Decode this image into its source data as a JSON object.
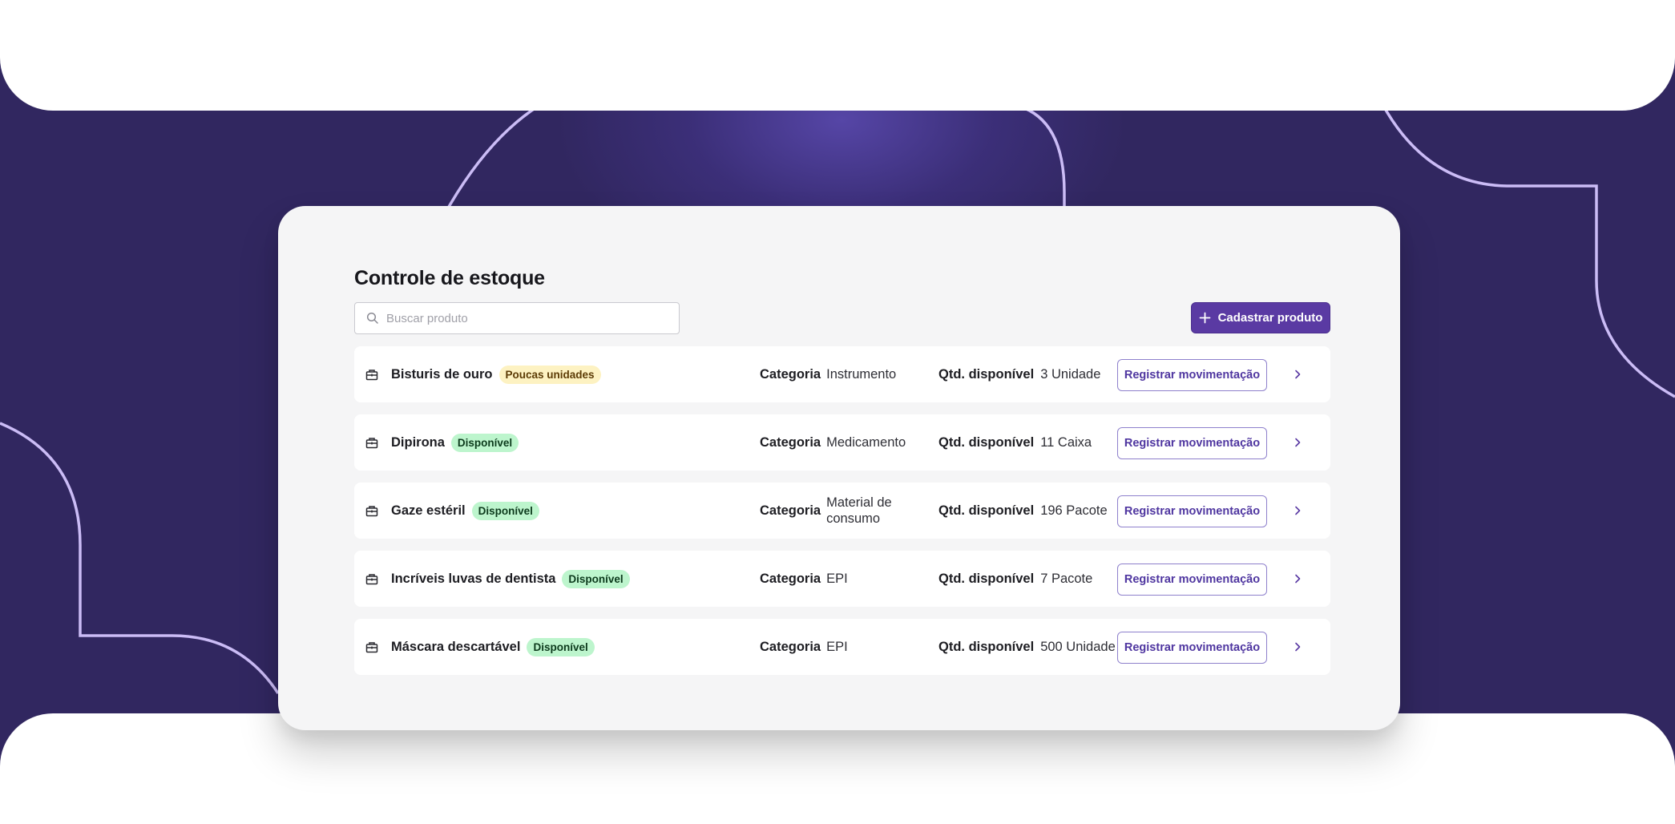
{
  "colors": {
    "background": "#312760",
    "accent": "#5a3aa3",
    "decoration_line": "#cbbcf6",
    "badge_low_bg": "#fdf2c2",
    "badge_ok_bg": "#bdf5cd"
  },
  "page": {
    "title": "Controle de estoque",
    "search_placeholder": "Buscar produto",
    "search_icon": "search-icon",
    "add_button_label": "Cadastrar produto",
    "add_button_icon": "plus-icon"
  },
  "rows": [
    {
      "name": "Bisturis de ouro",
      "badge": "Poucas unidades",
      "badge_kind": "low",
      "category_label": "Categoria",
      "category": "Instrumento",
      "qty_label": "Qtd. disponível",
      "qty": "3 Unidade",
      "action": "Registrar movimentação",
      "icon": "package-icon"
    },
    {
      "name": "Dipirona",
      "badge": "Disponível",
      "badge_kind": "ok",
      "category_label": "Categoria",
      "category": "Medicamento",
      "qty_label": "Qtd. disponível",
      "qty": "11 Caixa",
      "action": "Registrar movimentação",
      "icon": "package-icon"
    },
    {
      "name": "Gaze estéril",
      "badge": "Disponível",
      "badge_kind": "ok",
      "category_label": "Categoria",
      "category": "Material de consumo",
      "qty_label": "Qtd. disponível",
      "qty": "196 Pacote",
      "action": "Registrar movimentação",
      "icon": "package-icon"
    },
    {
      "name": "Incríveis luvas de dentista",
      "badge": "Disponível",
      "badge_kind": "ok",
      "category_label": "Categoria",
      "category": "EPI",
      "qty_label": "Qtd. disponível",
      "qty": "7 Pacote",
      "action": "Registrar movimentação",
      "icon": "package-icon"
    },
    {
      "name": "Máscara descartável",
      "badge": "Disponível",
      "badge_kind": "ok",
      "category_label": "Categoria",
      "category": "EPI",
      "qty_label": "Qtd. disponível",
      "qty": "500 Unidade",
      "action": "Registrar movimentação",
      "icon": "package-icon"
    }
  ]
}
